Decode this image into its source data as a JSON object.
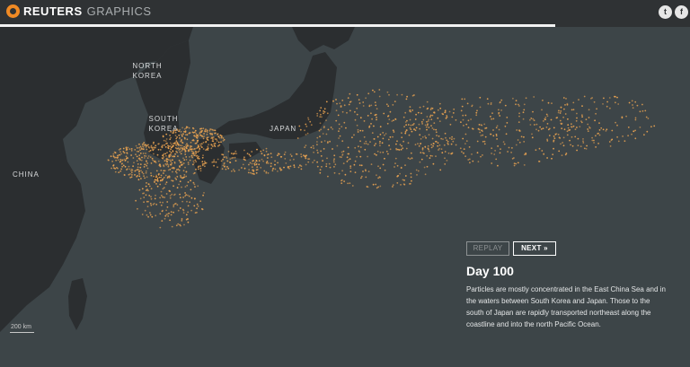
{
  "header": {
    "brand": "REUTERS",
    "brand_sub": "GRAPHICS",
    "social": [
      {
        "name": "twitter",
        "glyph": "t"
      },
      {
        "name": "facebook",
        "glyph": "f"
      }
    ]
  },
  "progress": {
    "fraction": 0.805
  },
  "map": {
    "labels": {
      "north_korea": "NORTH KOREA",
      "south_korea": "SOUTH KOREA",
      "japan": "JAPAN",
      "china": "CHINA"
    },
    "scale": "200 km",
    "particle_color": "#e8a251"
  },
  "panel": {
    "replay_label": "REPLAY",
    "next_label": "NEXT »",
    "title": "Day 100",
    "description": "Particles are mostly concentrated in the East China Sea and in the waters between South Korea and Japan. Those to the south of Japan are rapidly transported northeast along the coastline and into the north Pacific Ocean."
  },
  "colors": {
    "land": "#2b2e30",
    "sea": "#3d4548",
    "header": "#2f3234",
    "accent": "#f08a24"
  }
}
